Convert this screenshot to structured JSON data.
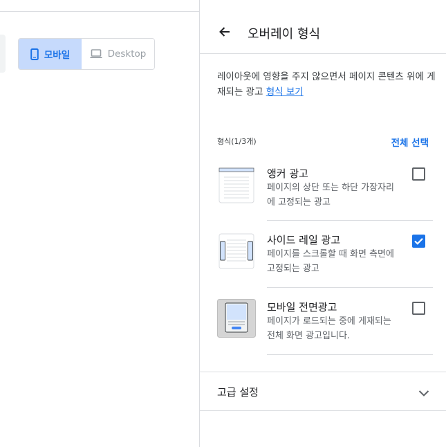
{
  "device_toggle": {
    "mobile_label": "모바일",
    "desktop_label": "Desktop",
    "mobile_icon": "smartphone-icon",
    "desktop_icon": "laptop-icon"
  },
  "panel": {
    "title": "오버레이 형식",
    "description": "레이아웃에 영향을 주지 않으면서 페이지 콘텐츠 위에 게재되는 광고",
    "description_link": "형식 보기",
    "format_count": "형식(1/3개)",
    "select_all": "전체 선택",
    "formats": [
      {
        "title": "앵커 광고",
        "desc_line1": "페이지의 상단 또는 하단 가장자리",
        "desc_line2": "에 고정되는 광고",
        "checked": false,
        "icon": "anchor-ad-icon"
      },
      {
        "title": "사이드 레일 광고",
        "desc_line1": "페이지를 스크롤할 때 화면 측면에",
        "desc_line2": "고정되는 광고",
        "checked": true,
        "icon": "side-rail-ad-icon"
      },
      {
        "title": "모바일 전면광고",
        "desc_line1": "페이지가 로드되는 중에 게재되는",
        "desc_line2": "전체 화면 광고입니다.",
        "checked": false,
        "icon": "mobile-interstitial-icon"
      }
    ],
    "advanced_label": "고급 설정"
  },
  "colors": {
    "accent": "#1a73e8",
    "toggle_active_bg": "#c6dafc",
    "divider": "#dadce0",
    "secondary_text": "#5f6368"
  }
}
